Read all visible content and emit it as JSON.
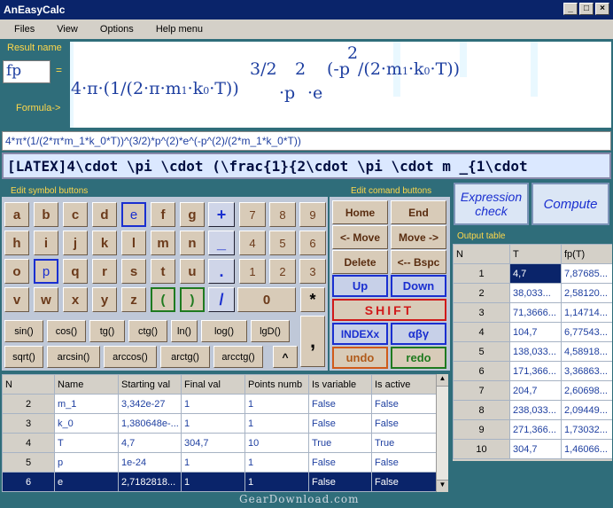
{
  "window": {
    "title": "AnEasyCalc",
    "buttons": [
      "_",
      "□",
      "×"
    ]
  },
  "menu": [
    "Files",
    "View",
    "Options",
    "Help menu"
  ],
  "result_label": "Result name",
  "result_value": "fp",
  "equals": "=",
  "formula_label": "Formula->",
  "formula": {
    "a": "4·π·(1/(2·π·m",
    "a_sub": "1",
    "b": "·k",
    "b_sub": "0",
    "c": "·T))",
    "exp1": "3/2",
    "d": "·p",
    "exp2": "2",
    "e": "·e",
    "f": "(-p",
    "exp3": "2",
    "g": "/(2·m",
    "g_sub": "1",
    "h": "·k",
    "h_sub": "0",
    "i": "·T))"
  },
  "expression": "4*π*(1/(2*π*m_1*k_0*T))^(3/2)*p^(2)*e^(-p^(2)/(2*m_1*k_0*T))",
  "latex": "[LATEX]4\\cdot \\pi \\cdot (\\frac{1}{2\\cdot \\pi \\cdot m _{1\\cdot",
  "symbol_label": "Edit symbol buttons",
  "command_label": "Edit comand buttons",
  "letters": [
    [
      "a",
      "b",
      "c",
      "d",
      "e",
      "f",
      "g"
    ],
    [
      "h",
      "i",
      "j",
      "k",
      "l",
      "m",
      "n"
    ],
    [
      "o",
      "p",
      "q",
      "r",
      "s",
      "t",
      "u"
    ],
    [
      "v",
      "w",
      "x",
      "y",
      "z",
      "(",
      ")"
    ]
  ],
  "operators": [
    "+",
    "_",
    ".",
    "/"
  ],
  "digits": [
    [
      "7",
      "8",
      "9"
    ],
    [
      "4",
      "5",
      "6"
    ],
    [
      "1",
      "2",
      "3"
    ]
  ],
  "zero": "0",
  "multiply": "*",
  "comma": ",",
  "power": "^",
  "funcs_row1": [
    "sin()",
    "cos()",
    "tg()",
    "ctg()",
    "ln()",
    "log()",
    "lgD()"
  ],
  "funcs_row2": [
    "sqrt()",
    "arcsin()",
    "arccos()",
    "arctg()",
    "arcctg()"
  ],
  "commands": {
    "home": "Home",
    "end": "End",
    "move_left": "<- Move",
    "move_right": "Move ->",
    "delete": "Delete",
    "bspc": "<-- Bspc",
    "up": "Up",
    "down": "Down",
    "shift": "SHIFT",
    "index": "INDEXx",
    "greek": "αβγ",
    "undo": "undo",
    "redo": "redo"
  },
  "expression_check": "Expression check",
  "compute": "Compute",
  "output_label": "Output table",
  "output_headers": [
    "N",
    "T",
    "fp(T)"
  ],
  "output_rows": [
    [
      "1",
      "4,7",
      "7,87685..."
    ],
    [
      "2",
      "38,033...",
      "2,58120..."
    ],
    [
      "3",
      "71,3666...",
      "1,14714..."
    ],
    [
      "4",
      "104,7",
      "6,77543..."
    ],
    [
      "5",
      "138,033...",
      "4,58918..."
    ],
    [
      "6",
      "171,366...",
      "3,36863..."
    ],
    [
      "7",
      "204,7",
      "2,60698..."
    ],
    [
      "8",
      "238,033...",
      "2,09449..."
    ],
    [
      "9",
      "271,366...",
      "1,73032..."
    ],
    [
      "10",
      "304,7",
      "1,46066..."
    ]
  ],
  "var_headers": [
    "N",
    "Name",
    "Starting val",
    "Final val",
    "Points numb",
    "Is variable",
    "Is active"
  ],
  "var_rows": [
    [
      "2",
      "m_1",
      "3,342e-27",
      "1",
      "1",
      "False",
      "False"
    ],
    [
      "3",
      "k_0",
      "1,380648e-...",
      "1",
      "1",
      "False",
      "False"
    ],
    [
      "4",
      "T",
      "4,7",
      "304,7",
      "10",
      "True",
      "True"
    ],
    [
      "5",
      "p",
      "1e-24",
      "1",
      "1",
      "False",
      "False"
    ],
    [
      "6",
      "e",
      "2,7182818...",
      "1",
      "1",
      "False",
      "False"
    ]
  ],
  "watermark": "GearDownload.com"
}
